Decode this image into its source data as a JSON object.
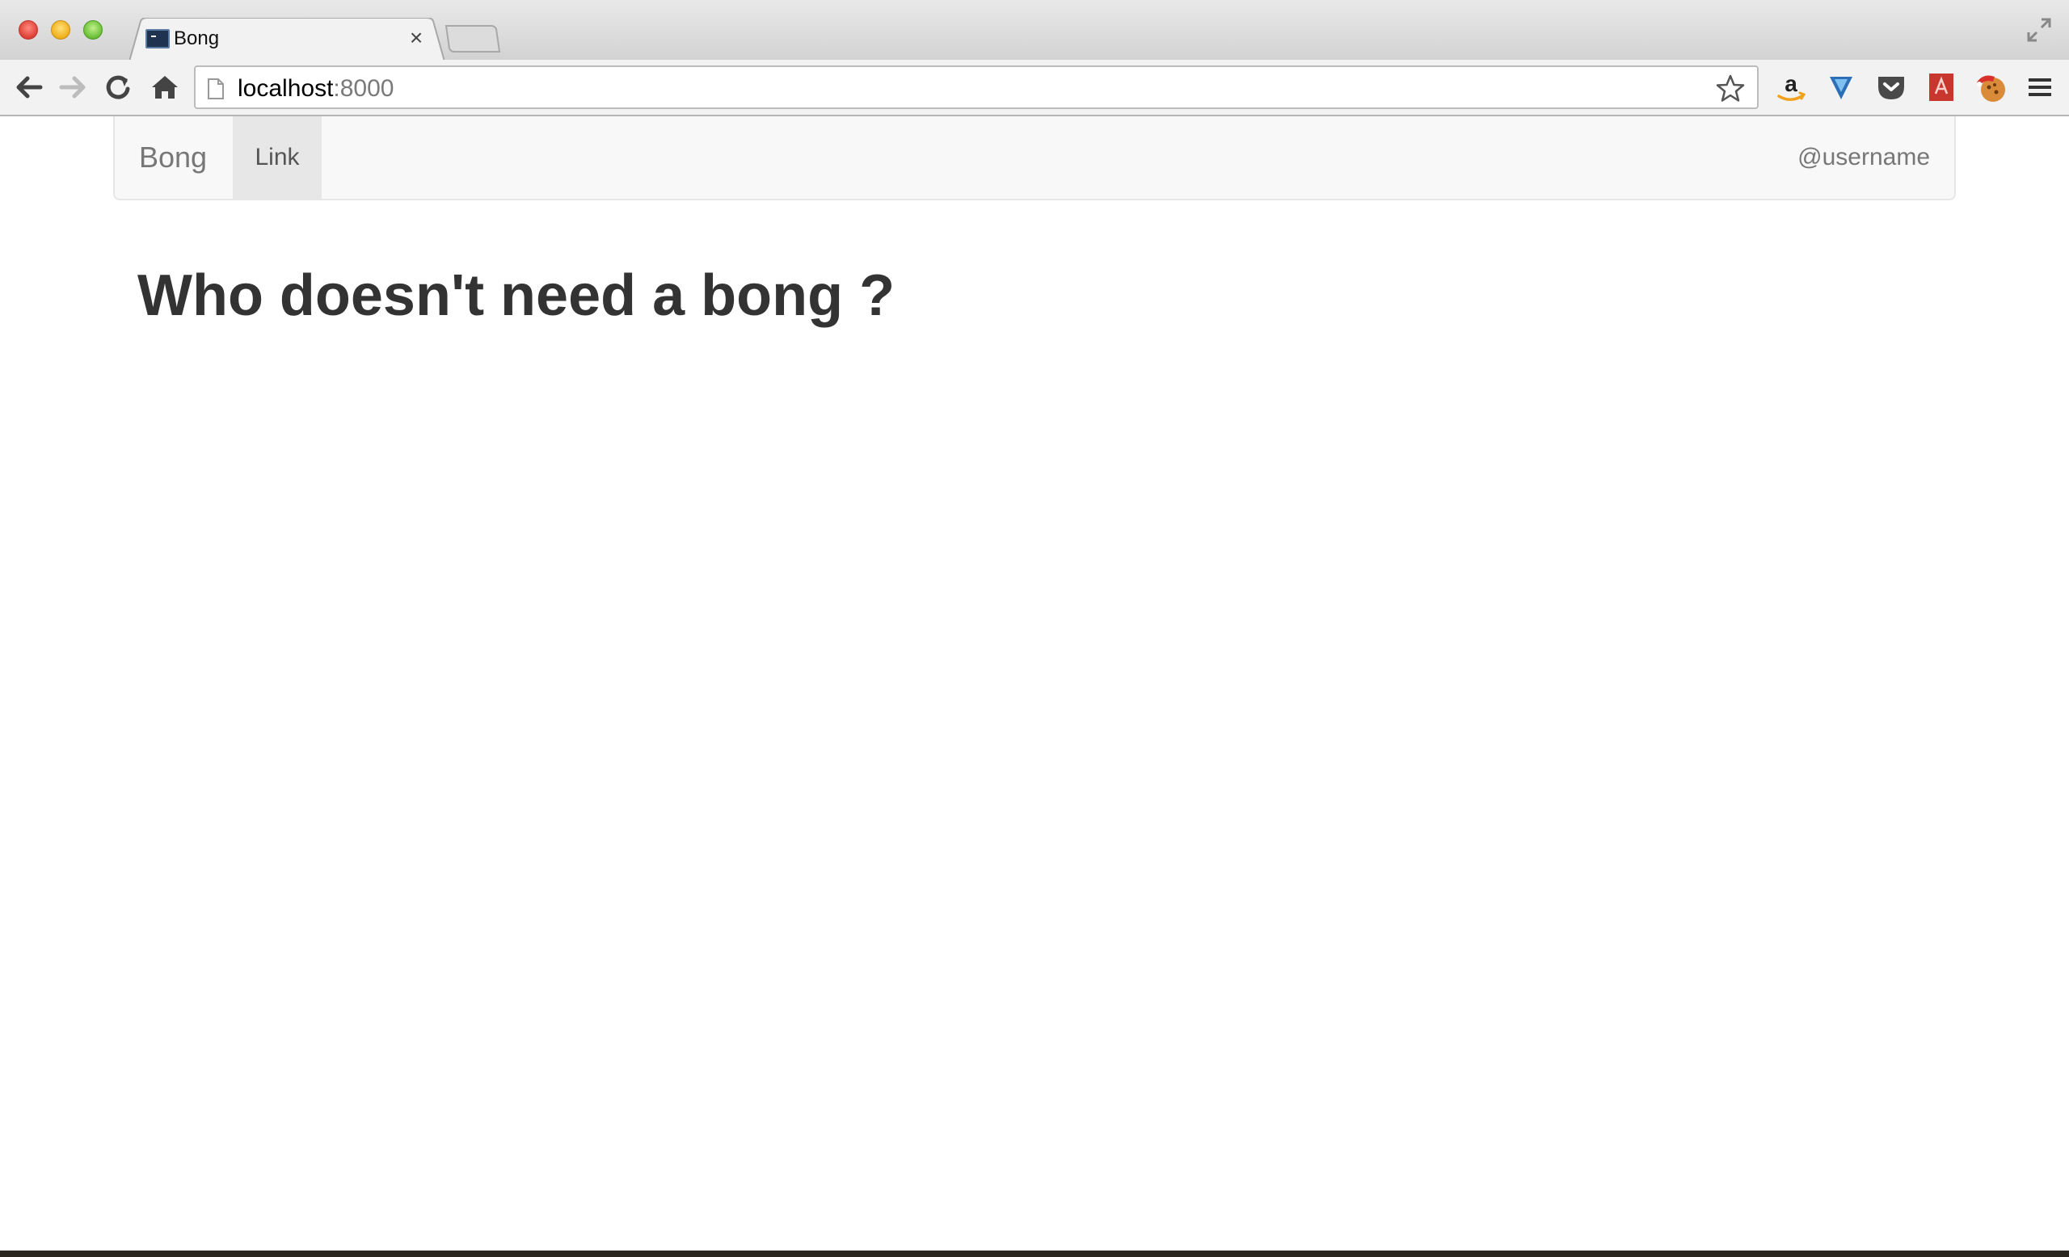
{
  "browser": {
    "tab": {
      "title": "Bong",
      "close_glyph": "×"
    },
    "url": {
      "host": "localhost",
      "port": ":8000"
    },
    "icons": {
      "back": "back-arrow-icon",
      "forward": "forward-arrow-icon",
      "reload": "reload-icon",
      "home": "home-icon",
      "bookmark": "star-icon",
      "menu": "hamburger-menu-icon",
      "extensions": [
        "amazon-icon",
        "ghostery-icon",
        "pocket-icon",
        "pdf-icon",
        "cookie-icon"
      ]
    }
  },
  "navbar": {
    "brand": "Bong",
    "link": "Link",
    "user": "@username"
  },
  "main": {
    "heading": "Who doesn't need a bong ?"
  },
  "colors": {
    "navbar_bg": "#f8f8f8",
    "active_link_bg": "#e7e7e7",
    "heading_text": "#333333",
    "brand_text": "#777777"
  }
}
